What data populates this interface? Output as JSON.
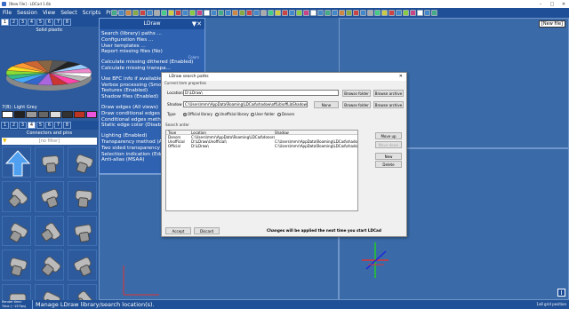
{
  "window": {
    "title": "[New File] - LDCad 1.6b"
  },
  "menu": [
    "File",
    "Session",
    "View",
    "Select",
    "Scripts",
    "Prefs"
  ],
  "left_panel": {
    "tabs": [
      "1",
      "2",
      "3",
      "4",
      "5",
      "6",
      "7",
      "8"
    ],
    "color_title": "Solid plastic",
    "selected_color": "7(B): Light Grey",
    "parts_tabs": [
      "1",
      "2",
      "3",
      "4",
      "5",
      "6",
      "7",
      "8"
    ],
    "parts_title": "Connectors and pins",
    "filter": "[no filter]"
  },
  "viewport": {
    "label": "[New file]"
  },
  "ldraw_menu": {
    "title": "LDraw",
    "items": [
      "Search (library) paths ...",
      "Configuration files ...",
      "User templates ...",
      "Report missing files (No)",
      "Calculate missing dithered (Enabled)",
      "Calculate missing transpa...",
      "Use BFC info if available (...",
      "Verbox processing (Smoot...",
      "Textures (Enabled)",
      "Shadow files (Enabled)",
      "Draw edges (All views)",
      "Draw conditional edges (A...",
      "Conditional edges method...",
      "Static edge color (Disable...",
      "Lighting (Enabled)",
      "Transparency method (Au...",
      "Two sided transparency (...",
      "Selection indication (Edge...",
      "Anti-alias (MSAA)"
    ],
    "sections": [
      "Colors",
      "Parts",
      "Edges",
      "Rendering"
    ]
  },
  "dialog": {
    "title": "LDraw search paths",
    "current_props": "Current item properties",
    "location_label": "Location",
    "location_value": "D:\\LDraw\\",
    "shadow_label": "Shadow",
    "shadow_value": "C:\\Users\\mmr\\AppData\\Roaming\\LDCad\\shadow\\offLib\\offLibShadow.csv",
    "btn_browse_folder": "Browse folder",
    "btn_browse_archive": "Browse archive",
    "btn_none": "None",
    "type_label": "Type",
    "types": [
      "Official library",
      "Unofficial library",
      "User folder",
      "Donors"
    ],
    "search_order": "Search order",
    "columns": [
      "Type",
      "Location",
      "Shadow"
    ],
    "rows": [
      [
        "Donors",
        "C:\\Users\\mmr\\AppData\\Roaming\\LDCad\\donors\\",
        ""
      ],
      [
        "Unofficial",
        "D:\\LDraw\\Unofficial\\",
        "C:\\Users\\mmr\\AppData\\Roaming\\LDCad\\shadow..."
      ],
      [
        "Official",
        "D:\\LDraw\\",
        "C:\\Users\\mmr\\AppData\\Roaming\\LDCad\\shadow..."
      ]
    ],
    "btn_move_up": "Move up",
    "btn_move_down": "Move down",
    "btn_new": "New",
    "btn_delete": "Delete",
    "btn_accept": "Accept",
    "btn_discard": "Discard",
    "footer_note": "Changes will be applied the next time you start LDCad"
  },
  "status": {
    "render_time": "Render time:",
    "frame_time": "Time (~157fps)",
    "message": "Manage LDraw library/search location(s).",
    "grid": "1x8 grid position"
  },
  "colors": {
    "panel": "#2c5a9c",
    "menubar": "#1f4f96",
    "viewport": "#3a6ba8"
  }
}
